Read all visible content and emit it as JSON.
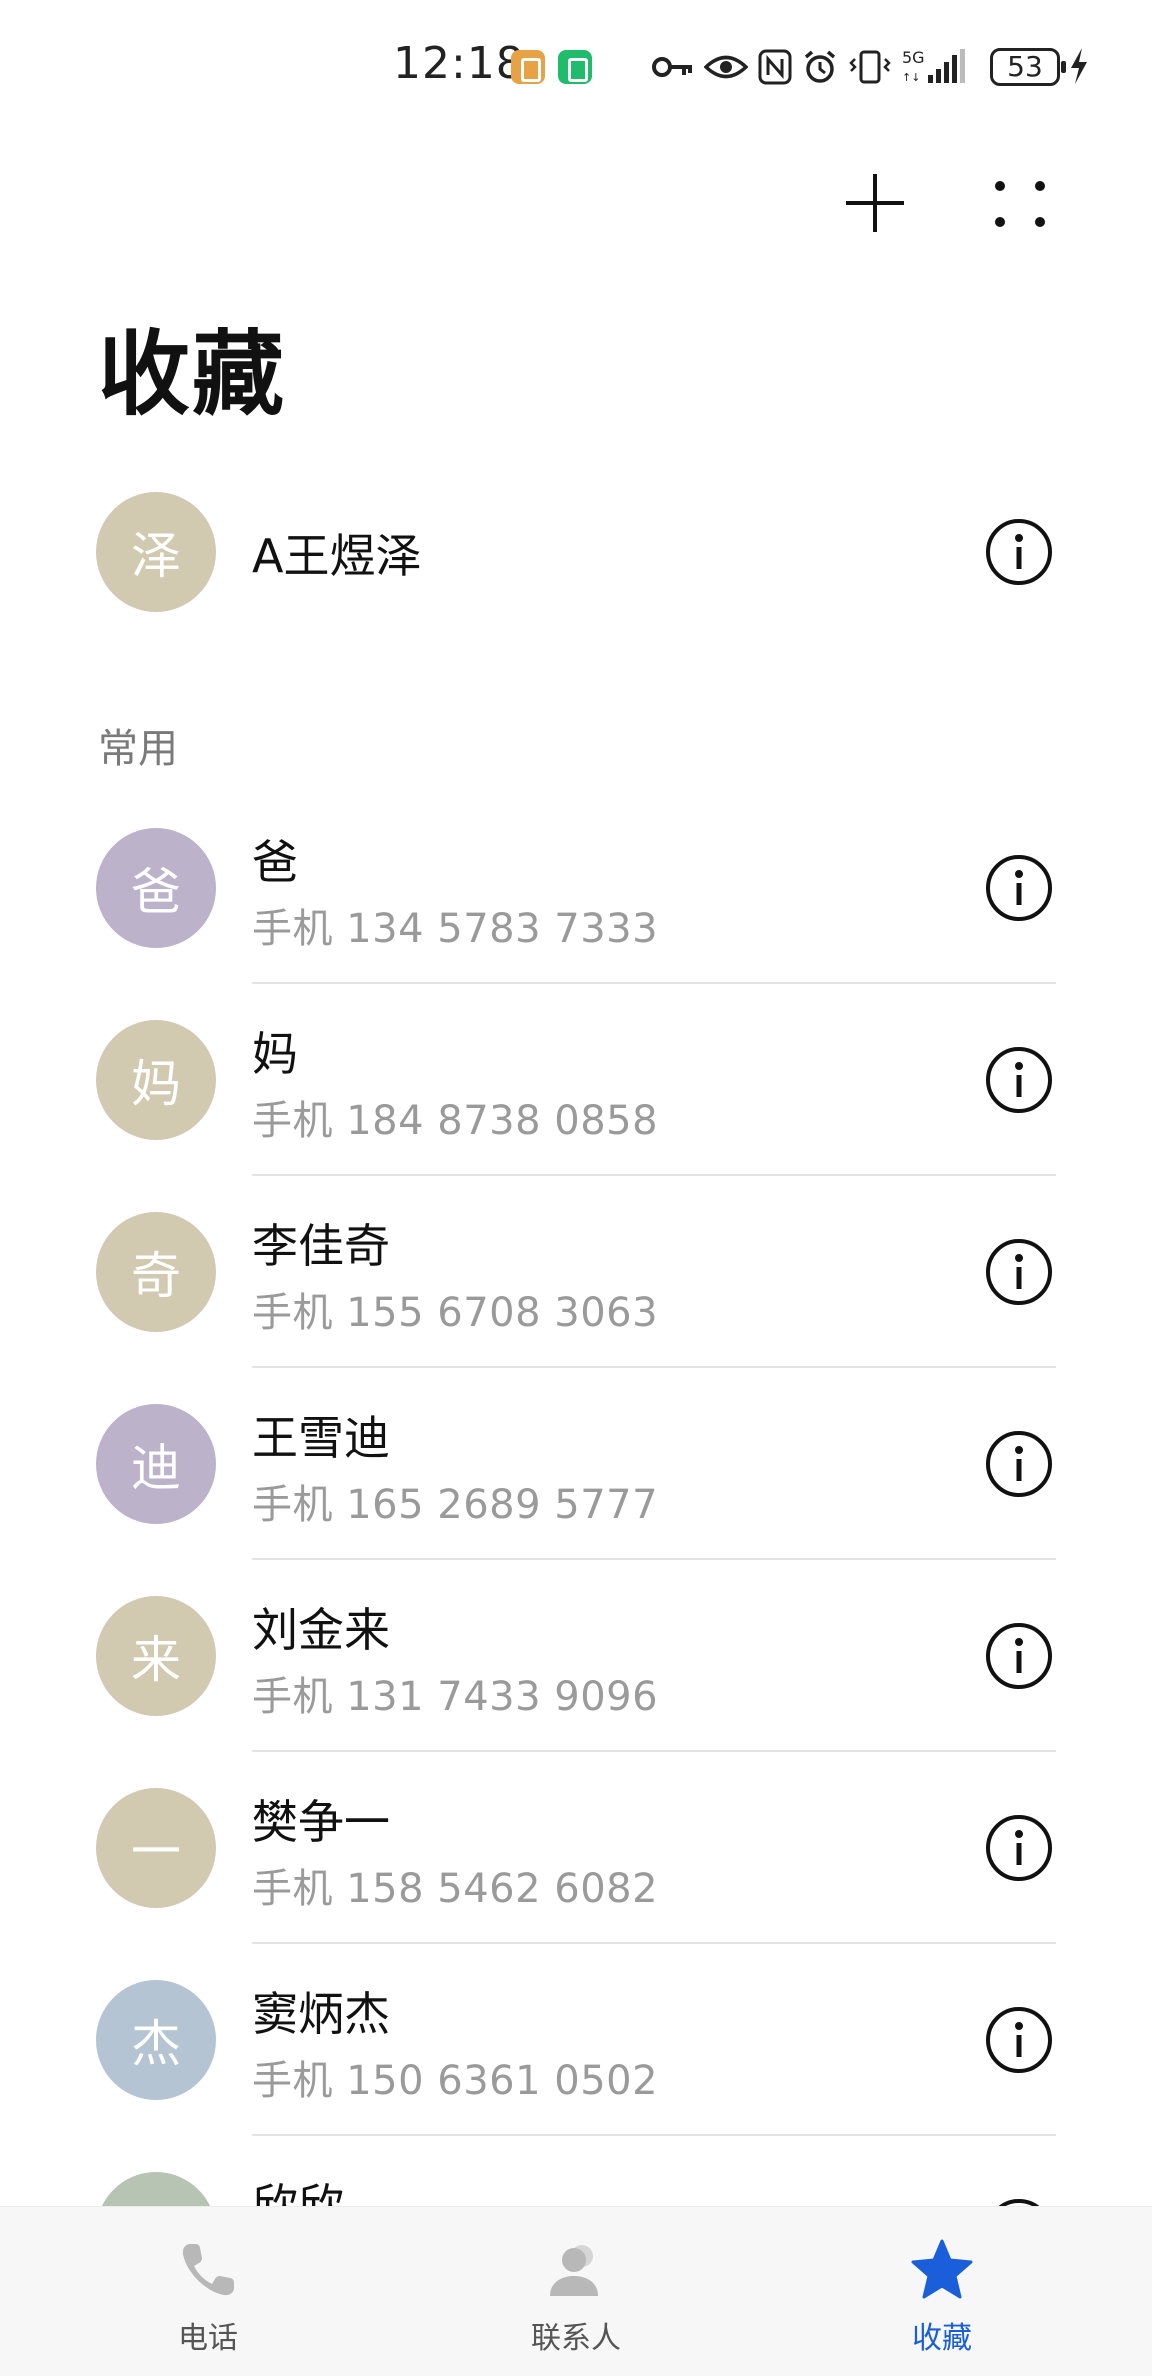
{
  "status_bar": {
    "time": "12:18",
    "battery": "53",
    "icons": [
      "key-icon",
      "eye-icon",
      "nfc-icon",
      "alarm-icon",
      "vibrate-icon",
      "5g-signal-icon",
      "battery-icon",
      "charging-icon"
    ]
  },
  "toolbar": {
    "add_icon": "plus-icon",
    "more_icon": "more-dots-icon"
  },
  "page": {
    "title": "收藏"
  },
  "favorite": {
    "initial": "泽",
    "name": "A王煜泽",
    "avatar_color": "#d2c9b1"
  },
  "frequent": {
    "header": "常用",
    "contacts": [
      {
        "initial": "爸",
        "name": "爸",
        "phone": "手机 134 5783 7333",
        "avatar_color": "#bcb2ca"
      },
      {
        "initial": "妈",
        "name": "妈",
        "phone": "手机 184 8738 0858",
        "avatar_color": "#d2c9b1"
      },
      {
        "initial": "奇",
        "name": "李佳奇",
        "phone": "手机 155 6708 3063",
        "avatar_color": "#d2c9b1"
      },
      {
        "initial": "迪",
        "name": "王雪迪",
        "phone": "手机 165 2689 5777",
        "avatar_color": "#bcb2ca"
      },
      {
        "initial": "来",
        "name": "刘金来",
        "phone": "手机 131 7433 9096",
        "avatar_color": "#d2c9b1"
      },
      {
        "initial": "一",
        "name": "樊争一",
        "phone": "手机 158 5462 6082",
        "avatar_color": "#d2c9b1"
      },
      {
        "initial": "杰",
        "name": "窦炳杰",
        "phone": "手机 150 6361 0502",
        "avatar_color": "#b5c4d3"
      },
      {
        "initial": "",
        "name": "欣欣",
        "phone": "",
        "avatar_color": "#b7c4b3"
      }
    ]
  },
  "bottom_nav": {
    "items": [
      {
        "label": "电话",
        "icon": "phone-icon",
        "active": false
      },
      {
        "label": "联系人",
        "icon": "contacts-icon",
        "active": false
      },
      {
        "label": "收藏",
        "icon": "star-icon",
        "active": true
      }
    ],
    "active_color": "#1a5fd9"
  }
}
